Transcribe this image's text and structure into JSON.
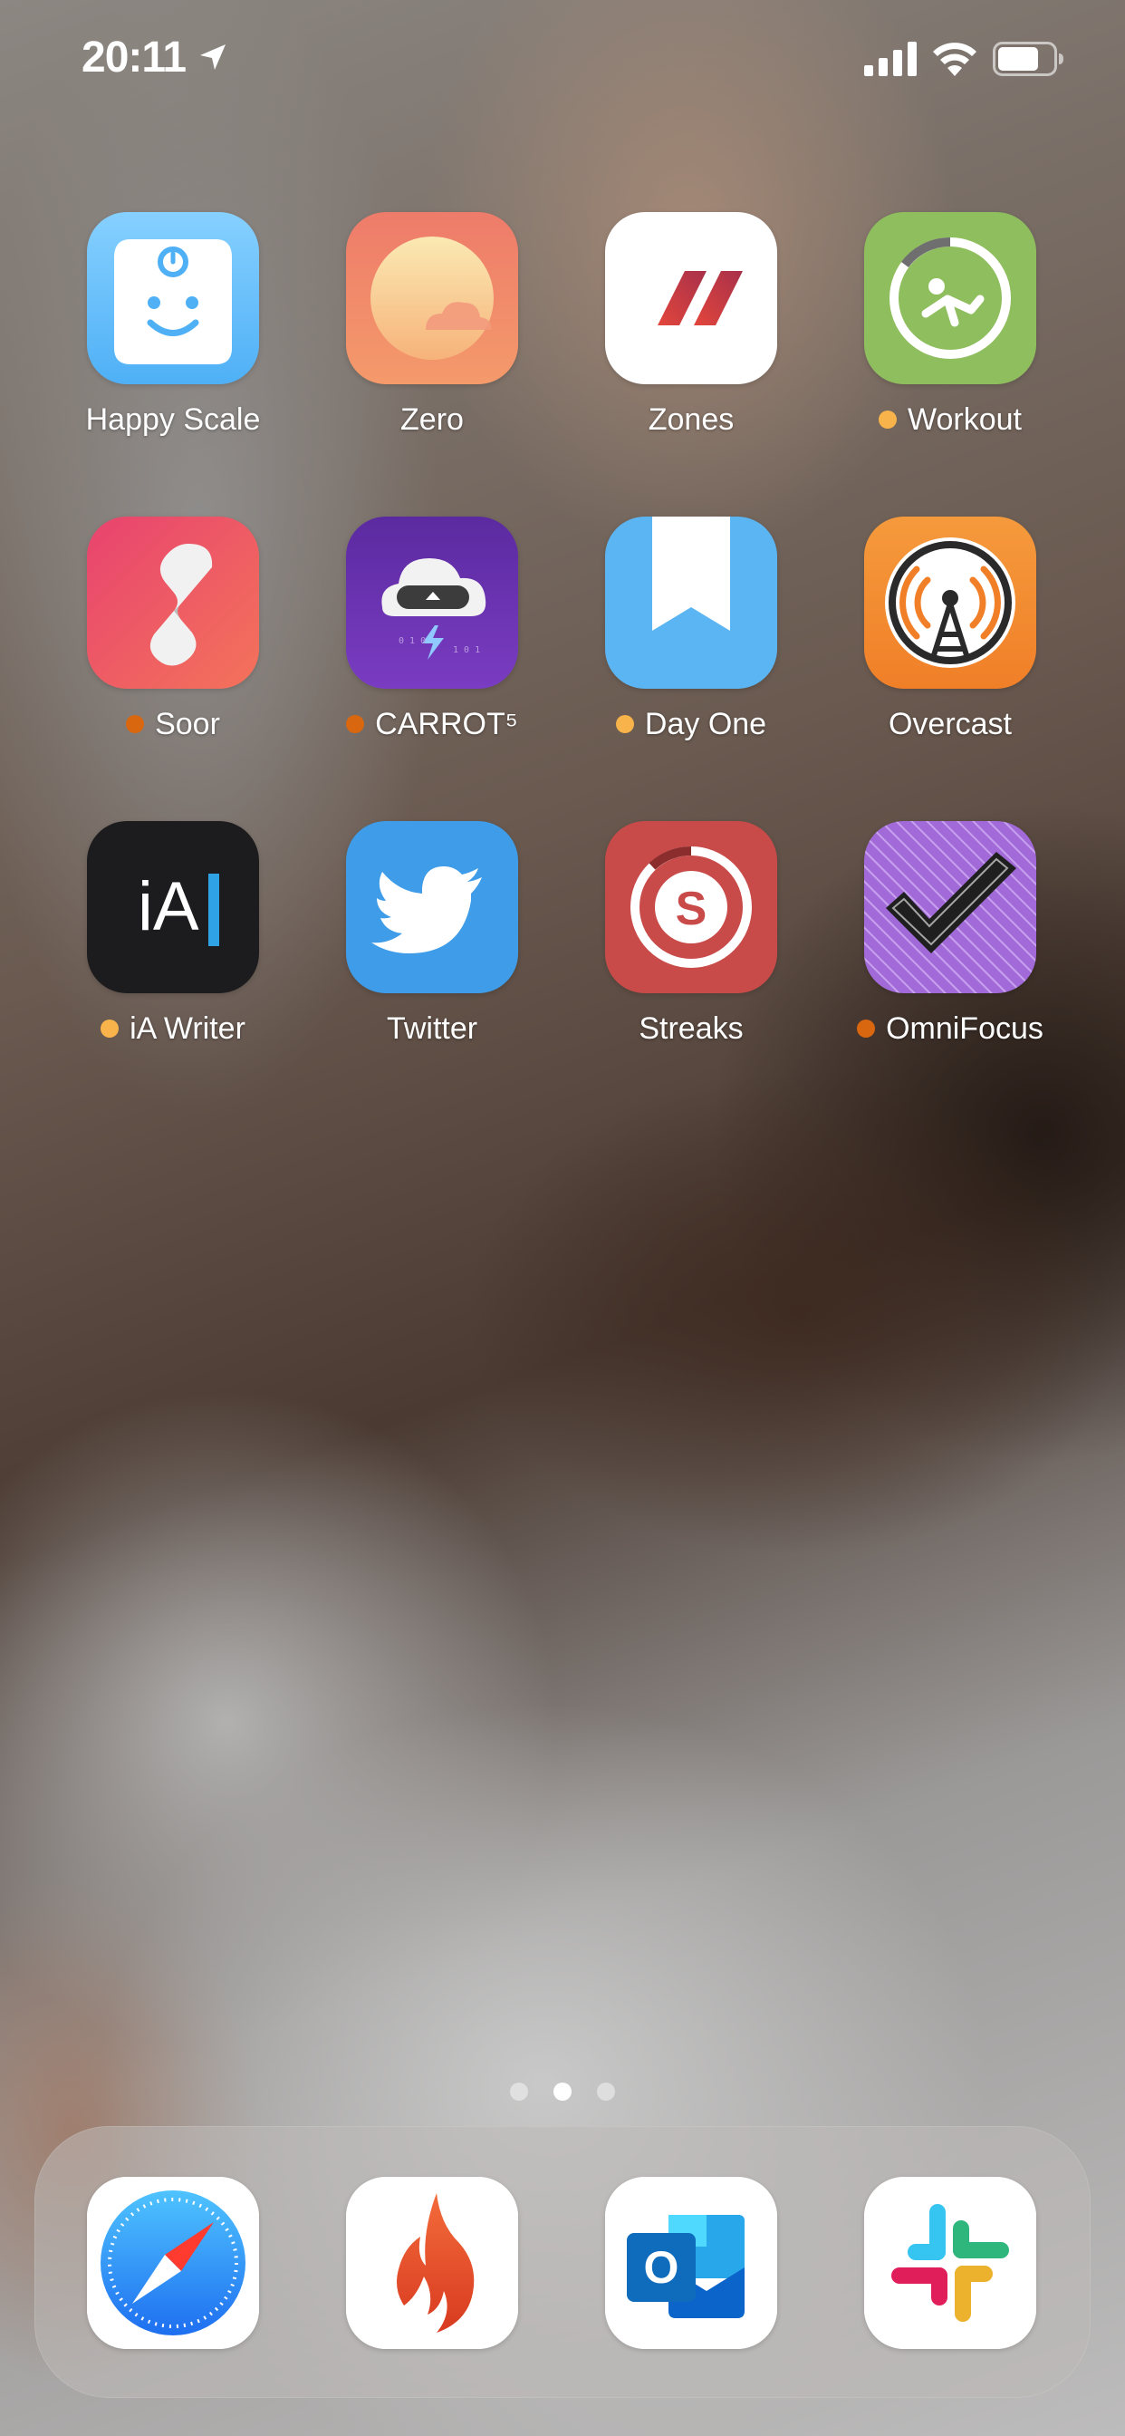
{
  "status_bar": {
    "time": "20:11",
    "icons": [
      "location-arrow-icon",
      "cellular-signal-icon",
      "wifi-icon",
      "battery-icon"
    ]
  },
  "home_screen": {
    "apps": [
      {
        "label": "Happy Scale",
        "icon": "happy-scale-icon",
        "new_dot": null
      },
      {
        "label": "Zero",
        "icon": "zero-icon",
        "new_dot": null
      },
      {
        "label": "Zones",
        "icon": "zones-icon",
        "new_dot": null
      },
      {
        "label": "Workout",
        "icon": "workout-icon",
        "new_dot": "yellow"
      },
      {
        "label": "Soor",
        "icon": "soor-icon",
        "new_dot": "orange"
      },
      {
        "label": "CARROT⁵",
        "icon": "carrot-weather-icon",
        "new_dot": "orange"
      },
      {
        "label": "Day One",
        "icon": "day-one-icon",
        "new_dot": "yellow"
      },
      {
        "label": "Overcast",
        "icon": "overcast-icon",
        "new_dot": null
      },
      {
        "label": "iA Writer",
        "icon": "ia-writer-icon",
        "new_dot": "yellow"
      },
      {
        "label": "Twitter",
        "icon": "twitter-icon",
        "new_dot": null
      },
      {
        "label": "Streaks",
        "icon": "streaks-icon",
        "new_dot": null
      },
      {
        "label": "OmniFocus",
        "icon": "omnifocus-icon",
        "new_dot": "orange"
      }
    ],
    "ia_writer_glyph": "iA",
    "streaks_glyph": "S"
  },
  "page_indicator": {
    "total": 3,
    "current": 2
  },
  "dock": {
    "apps": [
      "safari-icon",
      "codepoint-icon",
      "outlook-icon",
      "slack-icon"
    ],
    "outlook_glyph": "O"
  },
  "colors": {
    "new_dot_yellow": "#f8b34a",
    "new_dot_orange": "#d9670f",
    "label_text": "#ffffff"
  }
}
